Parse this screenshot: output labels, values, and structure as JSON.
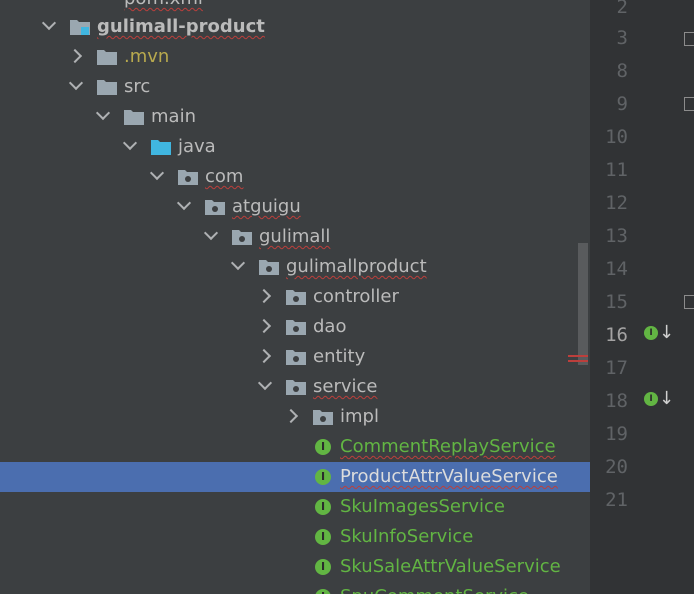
{
  "project_tree": {
    "nodes": [
      {
        "label": "pom.xml",
        "expanded": null
      },
      {
        "label": "gulimall-product",
        "expanded": true
      },
      {
        "label": ".mvn",
        "expanded": false
      },
      {
        "label": "src",
        "expanded": true
      },
      {
        "label": "main",
        "expanded": true
      },
      {
        "label": "java",
        "expanded": true
      },
      {
        "label": "com",
        "expanded": true
      },
      {
        "label": "atguigu",
        "expanded": true
      },
      {
        "label": "gulimall",
        "expanded": true
      },
      {
        "label": "gulimallproduct",
        "expanded": true
      },
      {
        "label": "controller",
        "expanded": false
      },
      {
        "label": "dao",
        "expanded": false
      },
      {
        "label": "entity",
        "expanded": false
      },
      {
        "label": "service",
        "expanded": true
      },
      {
        "label": "impl",
        "expanded": false
      },
      {
        "label": "CommentReplayService",
        "type": "interface"
      },
      {
        "label": "ProductAttrValueService",
        "type": "interface",
        "selected": true
      },
      {
        "label": "SkuImagesService",
        "type": "interface"
      },
      {
        "label": "SkuInfoService",
        "type": "interface"
      },
      {
        "label": "SkuSaleAttrValueService",
        "type": "interface"
      },
      {
        "label": "SpuCommentService",
        "type": "interface"
      }
    ],
    "interface_badge": "I"
  },
  "editor_gutter": {
    "line_numbers": [
      "2",
      "3",
      "8",
      "9",
      "10",
      "11",
      "12",
      "13",
      "14",
      "15",
      "16",
      "17",
      "18",
      "19",
      "20",
      "21"
    ],
    "current_line": "16",
    "implement_markers": [
      "16",
      "18"
    ],
    "implement_badge": "I",
    "implement_arrow": "↓"
  },
  "colors": {
    "panel_bg": "#3c3f41",
    "selection": "#4b6eaf",
    "interface_green": "#62b543",
    "folder_gray": "#9aa7b0",
    "source_folder_blue": "#40b6e0",
    "mvn_yellow": "#b8a94e",
    "error_red": "#bc3f3c"
  }
}
